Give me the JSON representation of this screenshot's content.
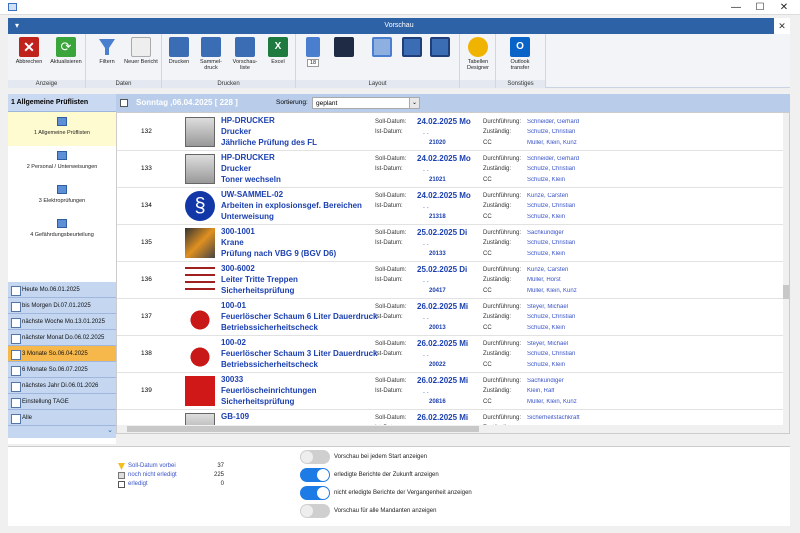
{
  "window": {
    "title": "Vorschau",
    "minimize": "—",
    "maximize": "☐",
    "close": "✕",
    "panel_close": "✕"
  },
  "ribbon": {
    "groups": [
      {
        "label": "Anzeige",
        "buttons": [
          "Abbrechen",
          "Aktualisieren"
        ]
      },
      {
        "label": "Daten",
        "buttons": [
          "Filtern",
          "Neuer Bericht"
        ]
      },
      {
        "label": "Drucken",
        "buttons": [
          "Drucken",
          "Sammel-druck",
          "Vorschau-liste",
          "Excel"
        ]
      },
      {
        "label": "Layout",
        "buttons": [
          "",
          "",
          "",
          "",
          ""
        ],
        "zoom": "18"
      },
      {
        "label": "",
        "buttons": [
          "Tabellen Designer"
        ]
      },
      {
        "label": "Sonstiges",
        "buttons": [
          "Outlook transfer"
        ]
      }
    ]
  },
  "left": {
    "header": "1 Allgemeine Prüflisten",
    "items": [
      "1 Allgemeine Prüflisten",
      "2 Personal / Unterweisungen",
      "3 Elektroprüfungen",
      "4 Gefährdungsbeurteilung"
    ],
    "dates": [
      "Heute Mo.06.01.2025",
      "bis Morgen Di.07.01.2025",
      "nächste Woche Mo.13.01.2025",
      "nächster Monat Do.06.02.2025",
      "3 Monate So.06.04.2025",
      "6 Monate So.06.07.2025",
      "nächstes Jahr Di.06.01.2026",
      "Einstellung TAGE",
      "Alle"
    ]
  },
  "topbar": {
    "date": "Sonntag ,06.04.2025   [ 228 ]",
    "sort_label": "Sortierung:",
    "sort_value": "geplant"
  },
  "labels": {
    "soll": "Soll-Datum:",
    "ist": "Ist-Datum:",
    "durch": "Durchführung:",
    "zust": "Zuständig:",
    "cc": "CC",
    "ist_placeholder": ". ."
  },
  "rows": [
    {
      "num": "132",
      "code": "HP-DRUCKER",
      "name": "Drucker",
      "task": "Jährliche Prüfung des FL",
      "soll": "24.02.2025 Mo",
      "nr": "21020",
      "d": "Schneider, Gerhard",
      "z": "Schulze, Christian",
      "cc": "Müller, Klein, Kunz",
      "img": "printer"
    },
    {
      "num": "133",
      "code": "HP-DRUCKER",
      "name": "Drucker",
      "task": "Toner wechseln",
      "soll": "24.02.2025 Mo",
      "nr": "21021",
      "d": "Schneider, Gerhard",
      "z": "Schulze, Christian",
      "cc": "Schulze, Klein",
      "img": "printer"
    },
    {
      "num": "134",
      "code": "UW-SAMMEL-02",
      "name": "Arbeiten in explosionsgef. Bereichen",
      "task": "Unterweisung",
      "soll": "24.02.2025 Mo",
      "nr": "21318",
      "d": "Kunze, Carsten",
      "z": "Schulze, Christian",
      "cc": "Schulze, Klein",
      "img": "paragraph"
    },
    {
      "num": "135",
      "code": "300-1001",
      "name": "Krane",
      "task": "Prüfung nach VBG 9 (BGV D6)",
      "soll": "25.02.2025 Di",
      "nr": "20133",
      "d": "Sachkundiger",
      "z": "Schulze, Christian",
      "cc": "Schulze, Klein",
      "img": "crane"
    },
    {
      "num": "136",
      "code": "300-6002",
      "name": "Leiter Tritte Treppen",
      "task": "Sicherheitsprüfung",
      "soll": "25.02.2025 Di",
      "nr": "20417",
      "d": "Kunze, Carsten",
      "z": "Müller, Horst",
      "cc": "Müller, Klein, Kunz",
      "img": "ladder"
    },
    {
      "num": "137",
      "code": "100-01",
      "name": "Feuerlöscher Schaum 6 Liter Dauerdruck",
      "task": "Betriebssicherheitscheck",
      "soll": "26.02.2025 Mi",
      "nr": "20013",
      "d": "Steyer, Michael",
      "z": "Schulze, Christian",
      "cc": "Schulze, Klein",
      "img": "extinguisher"
    },
    {
      "num": "138",
      "code": "100-02",
      "name": "Feuerlöscher Schaum 3 Liter Dauerdruck",
      "task": "Betriebssicherheitscheck",
      "soll": "26.02.2025 Mi",
      "nr": "20022",
      "d": "Steyer, Michael",
      "z": "Schulze, Christian",
      "cc": "Schulze, Klein",
      "img": "extinguisher"
    },
    {
      "num": "139",
      "code": "30033",
      "name": "Feuerlöscheinrichtungen",
      "task": "Sicherheitsprüfung",
      "soll": "26.02.2025 Mi",
      "nr": "20816",
      "d": "Sachkundiger",
      "z": "Klein, Ralf",
      "cc": "Müller, Klein, Kunz",
      "img": "hose"
    },
    {
      "num": "",
      "code": "GB-109",
      "name": "",
      "task": "",
      "soll": "26.02.2025 Mi",
      "nr": "",
      "d": "Sicherheitsfachkraft",
      "z": "",
      "cc": "",
      "img": "printer"
    }
  ],
  "stats": [
    {
      "label": "Soll-Datum vorbei",
      "value": "37"
    },
    {
      "label": "noch nicht erledigt",
      "value": "225"
    },
    {
      "label": "erledigt",
      "value": "0"
    }
  ],
  "toggles": [
    {
      "label": "Vorschau bei jedem Start anzeigen",
      "on": false
    },
    {
      "label": "erledigte Berichte der Zukunft anzeigen",
      "on": true
    },
    {
      "label": "nicht erledigte Berichte der Vergangenheit anzeigen",
      "on": true
    },
    {
      "label": "Vorschau für alle Mandanten anzeigen",
      "on": false
    }
  ],
  "colors": {
    "accent": "#2e62a6",
    "link": "#1a3fb0",
    "selected_date": "#f7b84b"
  }
}
